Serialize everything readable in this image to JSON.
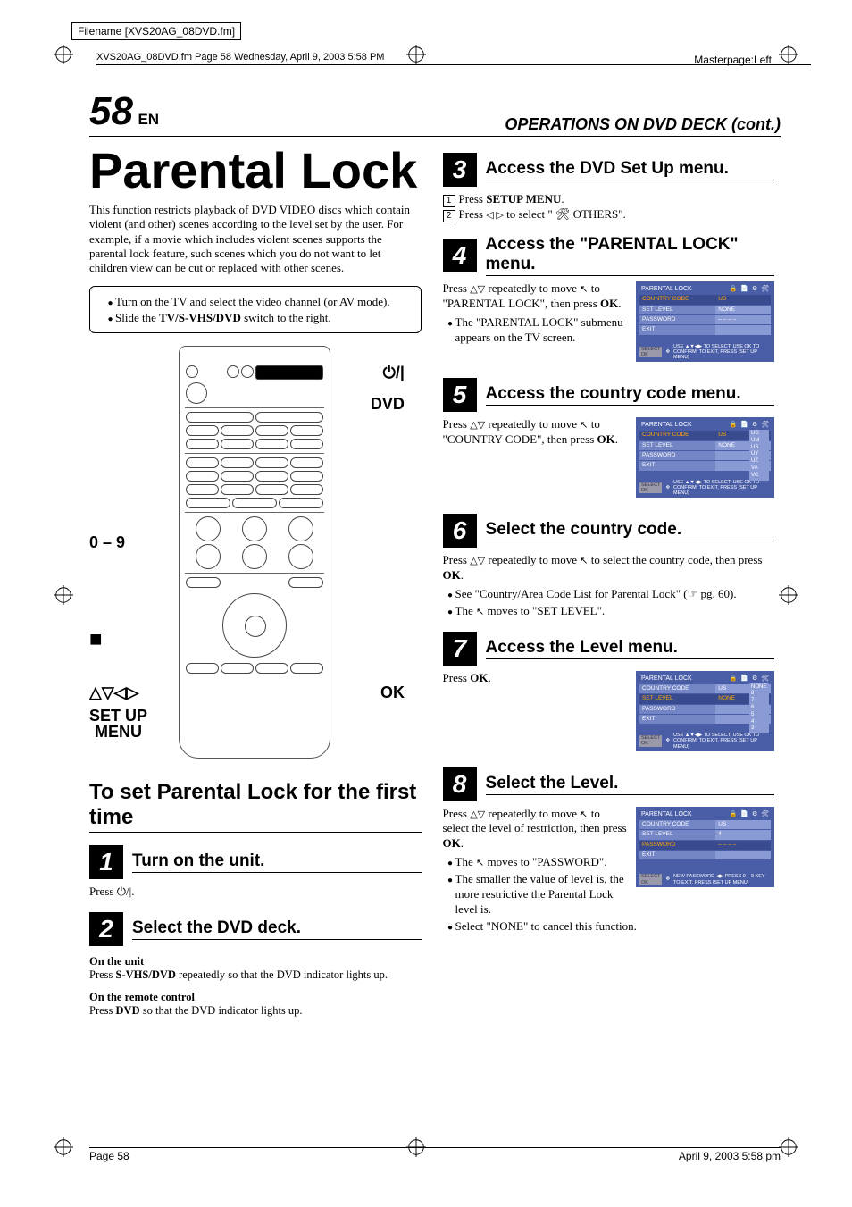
{
  "filename_box": "Filename [XVS20AG_08DVD.fm]",
  "fm_header": "XVS20AG_08DVD.fm  Page 58  Wednesday, April 9, 2003  5:58 PM",
  "masterpage": "Masterpage:Left",
  "page_num": "58",
  "page_lang": "EN",
  "section_header": "OPERATIONS ON DVD DECK (cont.)",
  "title": "Parental Lock",
  "intro": "This function restricts playback of DVD VIDEO discs which contain violent (and other) scenes according to the level set by the user. For example, if a movie which includes violent scenes supports the parental lock feature, such scenes which you do not want to let children view can be cut or replaced with other scenes.",
  "box": {
    "items": [
      "Turn on the TV and select the video channel (or AV mode).",
      "Slide the TV/S-VHS/DVD switch to the right."
    ]
  },
  "remote_labels": {
    "power": "⏻/|",
    "dvd": "DVD",
    "numbers": "0 – 9",
    "stop": "■",
    "arrows": "△▽◁▷",
    "ok": "OK",
    "setup": "SET UP MENU"
  },
  "proc_title": "To set Parental Lock for the first time",
  "steps_left": [
    {
      "n": "1",
      "title": "Turn on the unit.",
      "body_html": "Press ⏻/|."
    },
    {
      "n": "2",
      "title": "Select the DVD deck.",
      "sub1_label": "On the unit",
      "sub1_body": "Press S-VHS/DVD repeatedly so that the DVD indicator lights up.",
      "sub2_label": "On the remote control",
      "sub2_body": "Press DVD so that the DVD indicator lights up."
    }
  ],
  "steps_right": [
    {
      "n": "3",
      "title": "Access the DVD Set Up menu.",
      "lines": [
        {
          "num": "1",
          "text_a": "Press ",
          "bold": "SETUP MENU",
          "text_b": "."
        },
        {
          "num": "2",
          "text_a": "Press ◁ ▷ to select \" 🛠 OTHERS\".",
          "bold": "",
          "text_b": ""
        }
      ]
    },
    {
      "n": "4",
      "title": "Access the \"PARENTAL LOCK\" menu.",
      "body": "Press △▽ repeatedly to move ↖ to \"PARENTAL LOCK\", then press OK.",
      "bullets": [
        "The \"PARENTAL LOCK\" submenu appears on the TV screen."
      ],
      "osd": {
        "title": "PARENTAL LOCK",
        "rows": [
          {
            "l": "COUNTRY CODE",
            "r": "US",
            "sel": true
          },
          {
            "l": "SET LEVEL",
            "r": "NONE"
          },
          {
            "l": "PASSWORD",
            "r": "– – – –"
          },
          {
            "l": "EXIT",
            "r": ""
          }
        ],
        "foot": "USE ▲▼◀▶ TO SELECT, USE OK TO CONFIRM. TO EXIT, PRESS [SET UP MENU]"
      }
    },
    {
      "n": "5",
      "title": "Access the country code menu.",
      "body": "Press △▽ repeatedly to move ↖ to \"COUNTRY CODE\", then press OK.",
      "osd": {
        "title": "PARENTAL LOCK",
        "rows": [
          {
            "l": "COUNTRY CODE",
            "r": "US",
            "sel": true
          },
          {
            "l": "SET LEVEL",
            "r": "NONE"
          },
          {
            "l": "PASSWORD",
            "r": ""
          },
          {
            "l": "EXIT",
            "r": ""
          }
        ],
        "drop": [
          "UG",
          "UM",
          "US",
          "UY",
          "UZ",
          "VA",
          "VC"
        ],
        "foot": "USE ▲▼◀▶ TO SELECT, USE OK TO CONFIRM. TO EXIT, PRESS [SET UP MENU]"
      }
    },
    {
      "n": "6",
      "title": "Select the country code.",
      "body": "Press △▽ repeatedly to move ↖ to select the country code, then press OK.",
      "bullets": [
        "See \"Country/Area Code List for Parental Lock\" (☞ pg. 60).",
        "The ↖ moves to \"SET LEVEL\"."
      ]
    },
    {
      "n": "7",
      "title": "Access the Level menu.",
      "body": "Press OK.",
      "osd": {
        "title": "PARENTAL LOCK",
        "rows": [
          {
            "l": "COUNTRY CODE",
            "r": "US"
          },
          {
            "l": "SET LEVEL",
            "r": "NONE",
            "sel": true
          },
          {
            "l": "PASSWORD",
            "r": ""
          },
          {
            "l": "EXIT",
            "r": ""
          }
        ],
        "drop": [
          "NONE",
          "8",
          "7",
          "6",
          "5",
          "4",
          "3"
        ],
        "foot": "USE ▲▼◀▶ TO SELECT, USE OK TO CONFIRM. TO EXIT, PRESS [SET UP MENU]"
      }
    },
    {
      "n": "8",
      "title": "Select the Level.",
      "body": "Press △▽ repeatedly to move ↖ to select the level of restriction, then press OK.",
      "bullets": [
        "The ↖ moves to \"PASSWORD\".",
        "The smaller the value of level is, the more restrictive the Parental Lock level is.",
        "Select \"NONE\" to cancel this function."
      ],
      "osd": {
        "title": "PARENTAL LOCK",
        "rows": [
          {
            "l": "COUNTRY CODE",
            "r": "US"
          },
          {
            "l": "SET LEVEL",
            "r": "4"
          },
          {
            "l": "PASSWORD",
            "r": "– – – –",
            "sel": true
          },
          {
            "l": "EXIT",
            "r": ""
          }
        ],
        "foot": "NEW PASSWORD ◀▶ PRESS 0 – 9 KEY TO EXIT, PRESS [SET UP MENU]"
      }
    }
  ],
  "footer": {
    "left": "Page 58",
    "right": "April 9, 2003  5:58 pm"
  }
}
